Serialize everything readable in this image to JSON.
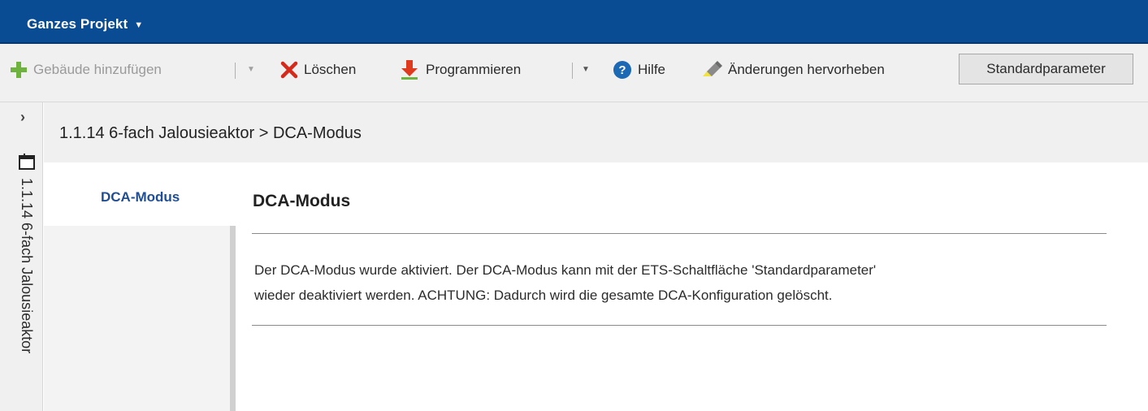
{
  "header": {
    "title": "Ganzes Projekt"
  },
  "toolbar": {
    "add_building": "Gebäude hinzufügen",
    "delete": "Löschen",
    "program": "Programmieren",
    "help": "Hilfe",
    "highlight_changes": "Änderungen hervorheben",
    "default_params": "Standardparameter"
  },
  "sidebar": {
    "device": "1.1.14 6-fach Jalousieaktor"
  },
  "breadcrumb": "1.1.14 6-fach Jalousieaktor > DCA-Modus",
  "nav": {
    "items": [
      {
        "label": "DCA-Modus"
      }
    ]
  },
  "content": {
    "heading": "DCA-Modus",
    "line1": "Der DCA-Modus wurde aktiviert. Der DCA-Modus kann mit der ETS-Schaltfläche 'Standardparameter'",
    "line2": "wieder deaktiviert werden. ACHTUNG: Dadurch wird die gesamte DCA-Konfiguration gelöscht."
  },
  "colors": {
    "titlebar": "#0a4c93",
    "nav_active": "#1f4e94",
    "delete_red": "#d42a1c",
    "help_blue": "#1b68b5"
  }
}
